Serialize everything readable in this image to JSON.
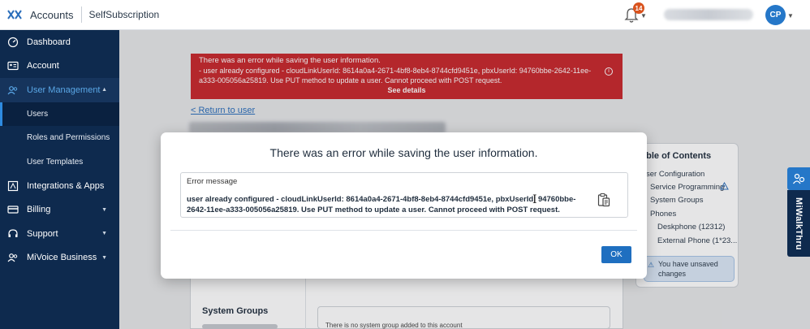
{
  "header": {
    "app_name": "Accounts",
    "tenant": "SelfSubscription",
    "notification_count": "14",
    "avatar_initials": "CP"
  },
  "sidebar": {
    "items": [
      {
        "label": "Dashboard",
        "icon": "dashboard-icon"
      },
      {
        "label": "Account",
        "icon": "account-card-icon"
      },
      {
        "label": "User Management",
        "icon": "users-icon",
        "expanded": true
      },
      {
        "label": "Integrations & Apps",
        "icon": "integrations-icon"
      },
      {
        "label": "Billing",
        "icon": "billing-card-icon"
      },
      {
        "label": "Support",
        "icon": "headset-icon"
      },
      {
        "label": "MiVoice Business",
        "icon": "mivoice-users-icon"
      }
    ],
    "user_management_sub": [
      "Users",
      "Roles and Permissions",
      "User Templates"
    ]
  },
  "banner": {
    "title": "There was an error while saving the user information.",
    "line1": "- user already configured - cloudLinkUserId: 8614a0a4-2671-4bf8-8eb4-8744cfd9451e, pbxUserId: 94760bbe-2642-11ee-",
    "line2": "a333-005056a25819. Use PUT method to update a user. Cannot proceed with POST request.",
    "see_details": "See details"
  },
  "back_link": "<  Return to user",
  "toc": {
    "title": "able of Contents",
    "items": [
      "ser Configuration",
      "Service Programming",
      "System Groups",
      "Phones",
      "Deskphone (12312)",
      "External Phone (1*23..."
    ],
    "unsaved": "You have unsaved changes"
  },
  "lower": {
    "system_groups": "System Groups",
    "no_groups": "There is no system group added to this account"
  },
  "walkthru": "MiWalkThru",
  "modal": {
    "title": "There was an error while saving the user information.",
    "label": "Error message",
    "message": "user already configured - cloudLinkUserId: 8614a0a4-2671-4bf8-8eb4-8744cfd9451e, pbxUserId: 94760bbe-2642-11ee-a333-005056a25819. Use PUT method to update a user. Cannot proceed with POST request.",
    "ok": "OK"
  },
  "colors": {
    "sidebar": "#0e2a4e",
    "error_red": "#c8272c",
    "primary_blue": "#1f6fc0",
    "badge_orange": "#d9531e"
  }
}
